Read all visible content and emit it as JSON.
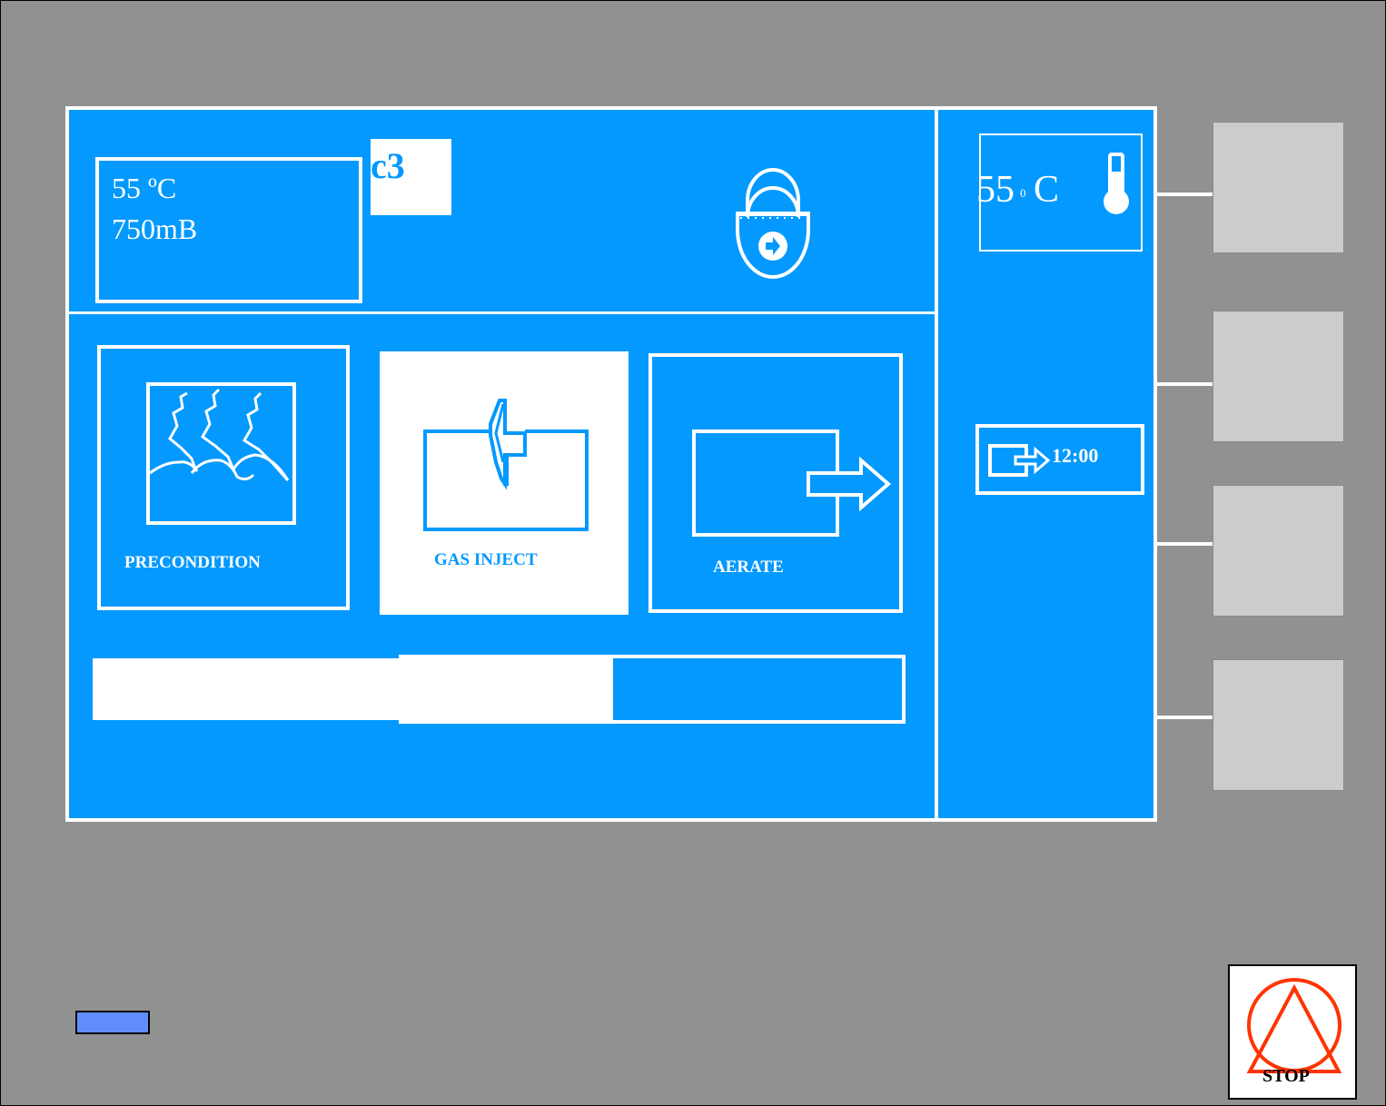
{
  "status": {
    "temperature": "55 ºC",
    "pressure": "750mB",
    "cycle_code": "c3"
  },
  "stages": [
    {
      "label": "PRECONDITION",
      "active": false
    },
    {
      "label": "GAS INJECT",
      "active": true
    },
    {
      "label": "AERATE",
      "active": false
    }
  ],
  "progress": {
    "fraction": 0.64
  },
  "side_panel": {
    "temp_value": "55",
    "temp_degree": "0",
    "temp_unit": "C",
    "timer": "12:00"
  },
  "icons": {
    "lock": "padlock-icon",
    "thermometer": "thermometer-icon",
    "precondition": "humidity-waves-icon",
    "gas_inject": "gas-inject-arrow-icon",
    "aerate": "aerate-arrow-icon",
    "timer": "exit-timer-icon",
    "stop": "stop-triangle-icon"
  },
  "stop_button": {
    "label": "STOP"
  },
  "colors": {
    "screen": "#0399fe",
    "bezel": "#919191",
    "side_button": "#cccccc",
    "indicator": "#5f8efc",
    "stop": "#ff3300"
  }
}
